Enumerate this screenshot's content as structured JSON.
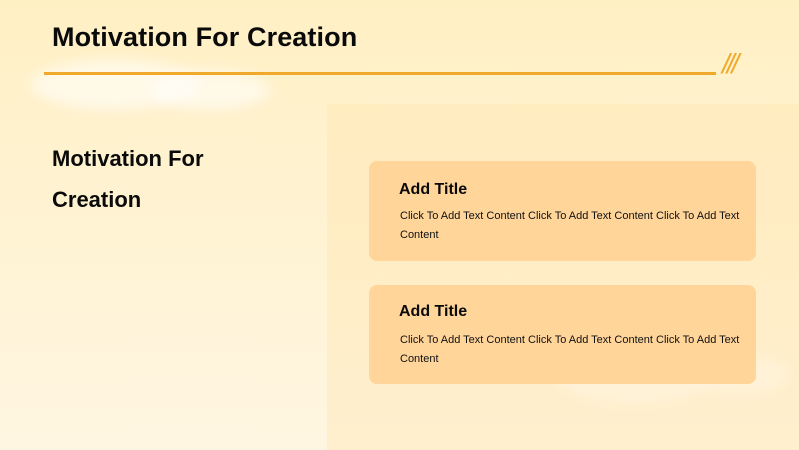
{
  "header": {
    "title": "Motivation For Creation",
    "decoration": "///",
    "accent_color": "#f0a92a"
  },
  "left": {
    "title": "Motivation For Creation"
  },
  "cards": [
    {
      "title": "Add Title",
      "text": "Click To Add Text Content Click To Add Text Content Click To Add Text Content"
    },
    {
      "title": "Add Title",
      "text": "Click To Add Text Content Click To Add Text Content Click To Add Text Content"
    }
  ],
  "colors": {
    "background": "#fff2d0",
    "card": "#ffd59a",
    "accent": "#f0a92a"
  }
}
